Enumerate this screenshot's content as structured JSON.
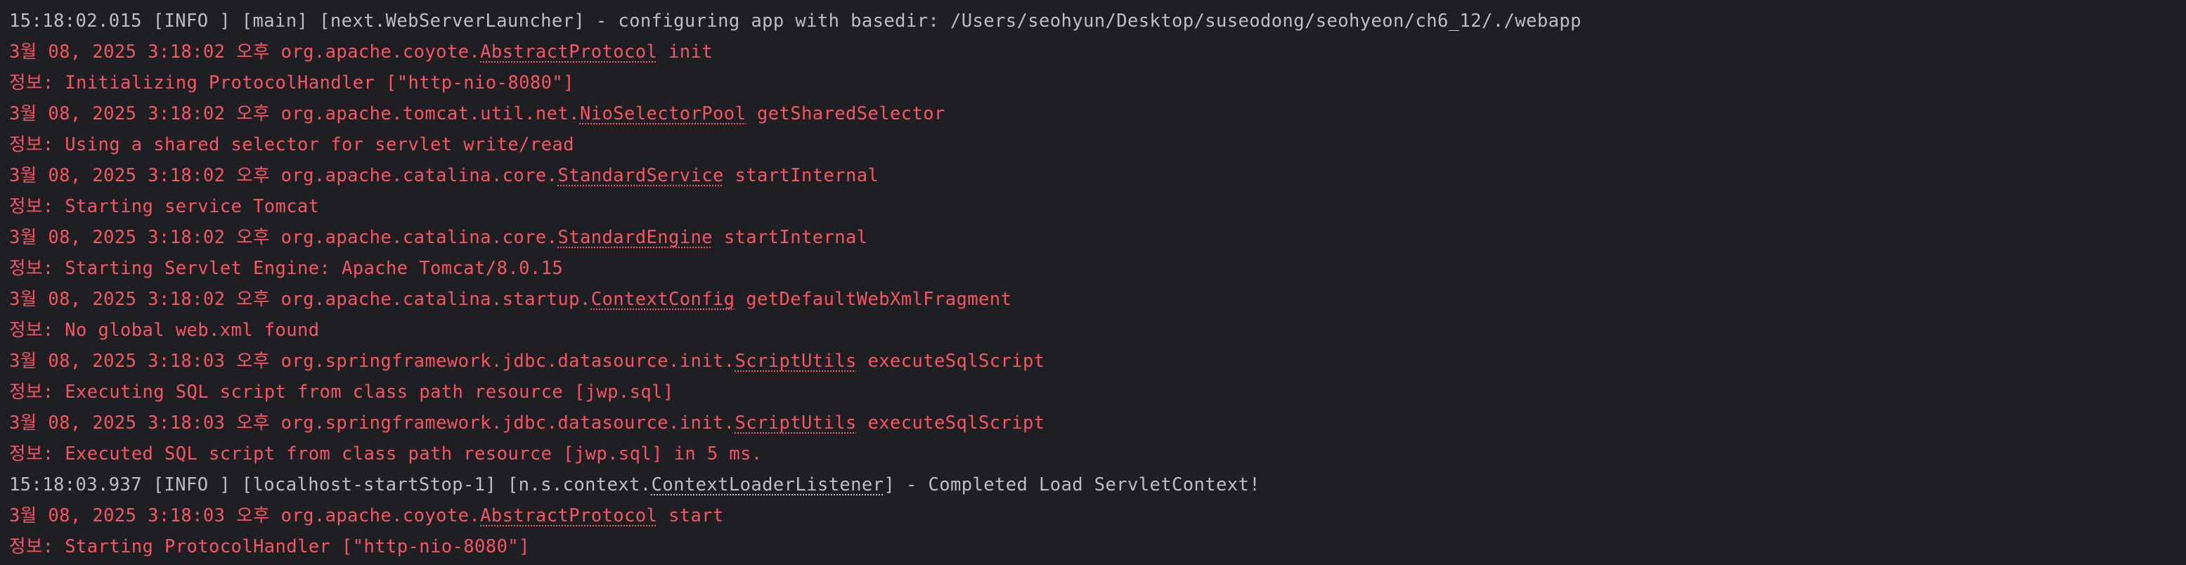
{
  "colors": {
    "background": "#1e1f22",
    "info_text": "#bcbec4",
    "stderr_text": "#f75464"
  },
  "console": {
    "lines": [
      {
        "kind": "info",
        "parts": [
          {
            "t": "15:18:02.015 [INFO ] [main] [next.WebServerLauncher] - configuring app with basedir: /Users/seohyun/Desktop/suseodong/seohyeon/ch6_12/./webapp"
          }
        ]
      },
      {
        "kind": "err",
        "parts": [
          {
            "t": "3월 08, 2025 3:18:02 오후 org.apache.coyote."
          },
          {
            "t": "AbstractProtocol",
            "link": true
          },
          {
            "t": " init"
          }
        ]
      },
      {
        "kind": "err",
        "parts": [
          {
            "t": "정보: Initializing ProtocolHandler [\"http-nio-8080\"]"
          }
        ]
      },
      {
        "kind": "err",
        "parts": [
          {
            "t": "3월 08, 2025 3:18:02 오후 org.apache.tomcat.util.net."
          },
          {
            "t": "NioSelectorPool",
            "link": true
          },
          {
            "t": " getSharedSelector"
          }
        ]
      },
      {
        "kind": "err",
        "parts": [
          {
            "t": "정보: Using a shared selector for servlet write/read"
          }
        ]
      },
      {
        "kind": "err",
        "parts": [
          {
            "t": "3월 08, 2025 3:18:02 오후 org.apache.catalina.core."
          },
          {
            "t": "StandardService",
            "link": true
          },
          {
            "t": " startInternal"
          }
        ]
      },
      {
        "kind": "err",
        "parts": [
          {
            "t": "정보: Starting service Tomcat"
          }
        ]
      },
      {
        "kind": "err",
        "parts": [
          {
            "t": "3월 08, 2025 3:18:02 오후 org.apache.catalina.core."
          },
          {
            "t": "StandardEngine",
            "link": true
          },
          {
            "t": " startInternal"
          }
        ]
      },
      {
        "kind": "err",
        "parts": [
          {
            "t": "정보: Starting Servlet Engine: Apache Tomcat/8.0.15"
          }
        ]
      },
      {
        "kind": "err",
        "parts": [
          {
            "t": "3월 08, 2025 3:18:02 오후 org.apache.catalina.startup."
          },
          {
            "t": "ContextConfig",
            "link": true
          },
          {
            "t": " getDefaultWebXmlFragment"
          }
        ]
      },
      {
        "kind": "err",
        "parts": [
          {
            "t": "정보: No global web.xml found"
          }
        ]
      },
      {
        "kind": "err",
        "parts": [
          {
            "t": "3월 08, 2025 3:18:03 오후 org.springframework.jdbc.datasource.init."
          },
          {
            "t": "ScriptUtils",
            "link": true
          },
          {
            "t": " executeSqlScript"
          }
        ]
      },
      {
        "kind": "err",
        "parts": [
          {
            "t": "정보: Executing SQL script from class path resource [jwp.sql]"
          }
        ]
      },
      {
        "kind": "err",
        "parts": [
          {
            "t": "3월 08, 2025 3:18:03 오후 org.springframework.jdbc.datasource.init."
          },
          {
            "t": "ScriptUtils",
            "link": true
          },
          {
            "t": " executeSqlScript"
          }
        ]
      },
      {
        "kind": "err",
        "parts": [
          {
            "t": "정보: Executed SQL script from class path resource [jwp.sql] in 5 ms."
          }
        ]
      },
      {
        "kind": "info",
        "parts": [
          {
            "t": "15:18:03.937 [INFO ] [localhost-startStop-1] [n.s.context."
          },
          {
            "t": "ContextLoaderListener",
            "link": true
          },
          {
            "t": "] - Completed Load ServletContext!"
          }
        ]
      },
      {
        "kind": "err",
        "parts": [
          {
            "t": "3월 08, 2025 3:18:03 오후 org.apache.coyote."
          },
          {
            "t": "AbstractProtocol",
            "link": true
          },
          {
            "t": " start"
          }
        ]
      },
      {
        "kind": "err",
        "parts": [
          {
            "t": "정보: Starting ProtocolHandler [\"http-nio-8080\"]"
          }
        ]
      }
    ]
  }
}
